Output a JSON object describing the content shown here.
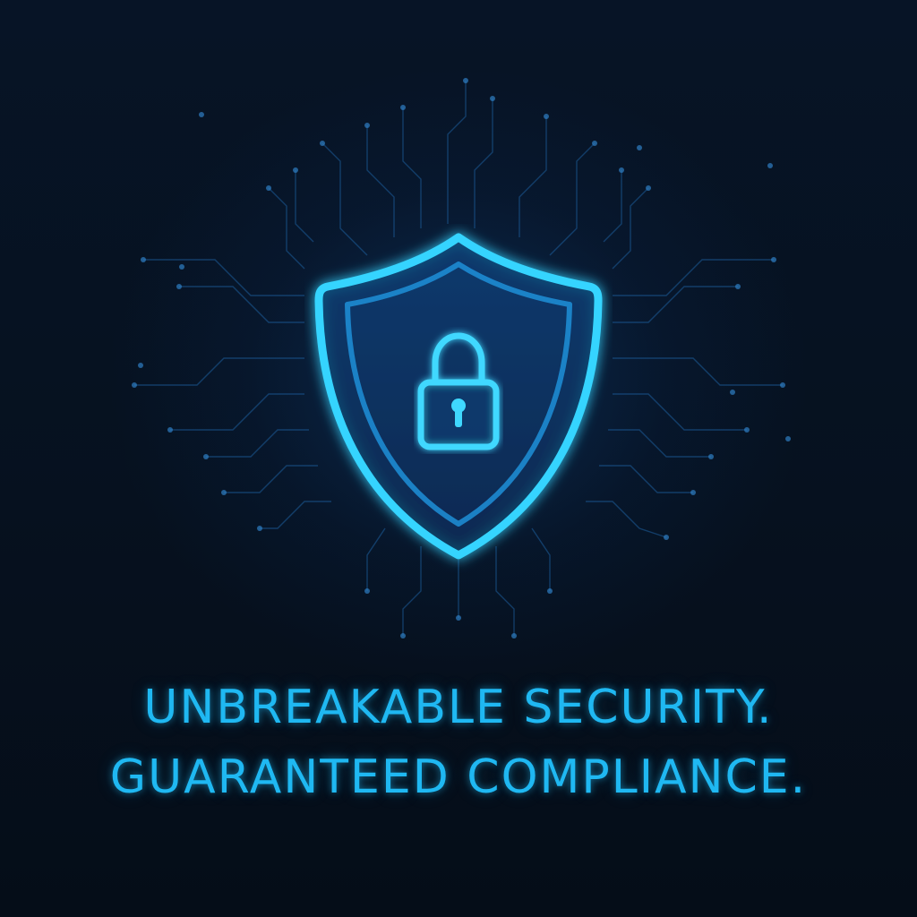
{
  "headline": {
    "line1": "UNBREAKABLE SECURITY.",
    "line2": "GUARANTEED COMPLIANCE."
  },
  "icons": {
    "main": "shield-icon",
    "inner": "padlock-icon",
    "background": "circuit-lines"
  },
  "colors": {
    "background": "#06111f",
    "accent": "#1fb8f2",
    "glow": "#35d4ff",
    "circuit": "#1d5f9e"
  }
}
